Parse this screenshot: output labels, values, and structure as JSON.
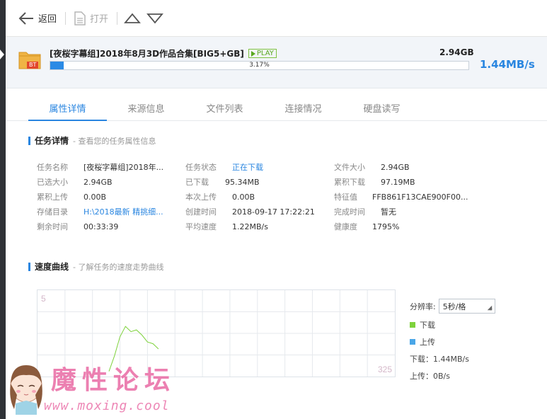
{
  "toolbar": {
    "back_label": "返回",
    "open_label": "打开"
  },
  "task": {
    "badge": "BT",
    "name": "[夜桜字幕组]2018年8月3D作品合集[BIG5+GB]",
    "play_label": "PLAY",
    "size": "2.94GB",
    "progress_text": "3.17%",
    "progress_fraction": 0.0317,
    "speed": "1.44MB/s"
  },
  "tabs": [
    {
      "label": "属性详情",
      "active": true
    },
    {
      "label": "来源信息"
    },
    {
      "label": "文件列表"
    },
    {
      "label": "连接情况"
    },
    {
      "label": "硬盘读写"
    }
  ],
  "details_section": {
    "title": "任务详情",
    "subtitle": "- 查看您的任务属性信息"
  },
  "details": {
    "col1": [
      {
        "label": "任务名称",
        "value": "[夜桜字幕组]2018年..."
      },
      {
        "label": "已选大小",
        "value": "2.94GB"
      },
      {
        "label": "累积上传",
        "value": "0.00B"
      },
      {
        "label": "存储目录",
        "value": "H:\\2018最新 精挑细..."
      },
      {
        "label": "剩余时间",
        "value": "00:33:39"
      }
    ],
    "col2": [
      {
        "label": "任务状态",
        "value": "正在下载"
      },
      {
        "label": "已下载",
        "value": "95.34MB"
      },
      {
        "label": "本次上传",
        "value": "0.00B"
      },
      {
        "label": "创建时间",
        "value": "2018-09-17 17:22:21"
      },
      {
        "label": "平均速度",
        "value": "1.22MB/s"
      }
    ],
    "col3": [
      {
        "label": "文件大小",
        "value": "2.94GB"
      },
      {
        "label": "累积下载",
        "value": "97.19MB"
      },
      {
        "label": "特征值",
        "value": "FFB861F13CAE900F00..."
      },
      {
        "label": "完成时间",
        "value": "暂无"
      },
      {
        "label": "健康度",
        "value": "1795%"
      }
    ]
  },
  "speed_section": {
    "title": "速度曲线",
    "subtitle": "- 了解任务的速度走势曲线"
  },
  "chart_data": {
    "type": "line",
    "y_top_label": "5",
    "x_right_label": "325",
    "grid": true,
    "series": [
      {
        "name": "下载",
        "color": "#7ed23c",
        "x": [
          13,
          14,
          15,
          16,
          17,
          18,
          19,
          20,
          21,
          22
        ],
        "values": [
          0.3,
          1.2,
          2.3,
          2.9,
          2.6,
          2.7,
          2.4,
          2.0,
          1.9,
          1.6
        ]
      },
      {
        "name": "上传",
        "color": "#4aa6e8",
        "x": [],
        "values": []
      }
    ]
  },
  "chart_side": {
    "resolution_label": "分辨率:",
    "resolution_value": "5秒/格",
    "legend_download": "下载",
    "legend_upload": "上传",
    "download_stat": "下载：1.44MB/s",
    "upload_stat": "上传：0B/s",
    "download_color": "#7ed23c",
    "upload_color": "#4aa6e8"
  },
  "watermark": {
    "title": "魔性论坛",
    "url": "www.moxing.cool"
  }
}
